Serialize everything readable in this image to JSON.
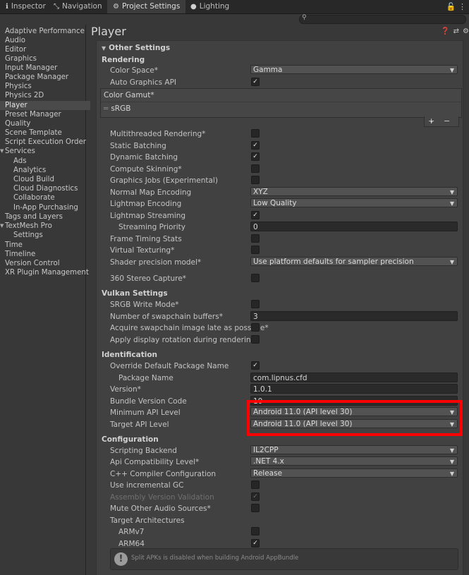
{
  "tabs": [
    {
      "label": "Inspector",
      "icon": "info-icon"
    },
    {
      "label": "Navigation",
      "icon": "navigation-icon"
    },
    {
      "label": "Project Settings",
      "icon": "gear-icon"
    },
    {
      "label": "Lighting",
      "icon": "bulb-icon"
    }
  ],
  "sidebar": {
    "items": [
      {
        "label": "Adaptive Performance"
      },
      {
        "label": "Audio"
      },
      {
        "label": "Editor"
      },
      {
        "label": "Graphics"
      },
      {
        "label": "Input Manager"
      },
      {
        "label": "Package Manager"
      },
      {
        "label": "Physics"
      },
      {
        "label": "Physics 2D"
      },
      {
        "label": "Player"
      },
      {
        "label": "Preset Manager"
      },
      {
        "label": "Quality"
      },
      {
        "label": "Scene Template"
      },
      {
        "label": "Script Execution Order"
      },
      {
        "label": "Services"
      },
      {
        "label": "Ads"
      },
      {
        "label": "Analytics"
      },
      {
        "label": "Cloud Build"
      },
      {
        "label": "Cloud Diagnostics"
      },
      {
        "label": "Collaborate"
      },
      {
        "label": "In-App Purchasing"
      },
      {
        "label": "Tags and Layers"
      },
      {
        "label": "TextMesh Pro"
      },
      {
        "label": "Settings"
      },
      {
        "label": "Time"
      },
      {
        "label": "Timeline"
      },
      {
        "label": "Version Control"
      },
      {
        "label": "XR Plugin Management"
      }
    ],
    "selected": "Player"
  },
  "main": {
    "title": "Player",
    "foldout": "Other Settings",
    "sections": {
      "rendering": "Rendering",
      "vulkan": "Vulkan Settings",
      "identification": "Identification",
      "configuration": "Configuration"
    },
    "fields": {
      "color_space": {
        "label": "Color Space*",
        "value": "Gamma"
      },
      "auto_graphics_api": {
        "label": "Auto Graphics API",
        "checked": true
      },
      "color_gamut": {
        "label": "Color Gamut*",
        "item": "sRGB"
      },
      "multithreaded": {
        "label": "Multithreaded Rendering*",
        "checked": false
      },
      "static_batching": {
        "label": "Static Batching",
        "checked": true
      },
      "dynamic_batching": {
        "label": "Dynamic Batching",
        "checked": true
      },
      "compute_skinning": {
        "label": "Compute Skinning*",
        "checked": false
      },
      "graphics_jobs": {
        "label": "Graphics Jobs (Experimental)",
        "checked": false
      },
      "normal_map": {
        "label": "Normal Map Encoding",
        "value": "XYZ"
      },
      "lightmap_encoding": {
        "label": "Lightmap Encoding",
        "value": "Low Quality"
      },
      "lightmap_streaming": {
        "label": "Lightmap Streaming",
        "checked": true
      },
      "streaming_priority": {
        "label": "Streaming Priority",
        "value": "0"
      },
      "frame_timing": {
        "label": "Frame Timing Stats",
        "checked": false
      },
      "virtual_texturing": {
        "label": "Virtual Texturing*",
        "checked": false
      },
      "shader_precision": {
        "label": "Shader precision model*",
        "value": "Use platform defaults for sampler precision"
      },
      "stereo_capture": {
        "label": "360 Stereo Capture*",
        "checked": false
      },
      "srgb_write": {
        "label": "SRGB Write Mode*",
        "checked": false
      },
      "swapchain_buffers": {
        "label": "Number of swapchain buffers*",
        "value": "3"
      },
      "acquire_swapchain": {
        "label": "Acquire swapchain image late as possible*",
        "checked": false
      },
      "display_rotation": {
        "label": "Apply display rotation during rendering",
        "checked": false
      },
      "override_package": {
        "label": "Override Default Package Name",
        "checked": true
      },
      "package_name": {
        "label": "Package Name",
        "value": "com.lipnus.cfd"
      },
      "version": {
        "label": "Version*",
        "value": "1.0.1"
      },
      "bundle_code": {
        "label": "Bundle Version Code",
        "value": "10"
      },
      "min_api": {
        "label": "Minimum API Level",
        "value": "Android 11.0 (API level 30)"
      },
      "target_api": {
        "label": "Target API Level",
        "value": "Android 11.0 (API level 30)"
      },
      "scripting_backend": {
        "label": "Scripting Backend",
        "value": "IL2CPP"
      },
      "api_compat": {
        "label": "Api Compatibility Level*",
        "value": ".NET 4.x"
      },
      "cpp_compiler": {
        "label": "C++ Compiler Configuration",
        "value": "Release"
      },
      "incremental_gc": {
        "label": "Use incremental GC",
        "checked": false
      },
      "assembly_validation": {
        "label": "Assembly Version Validation",
        "checked": true
      },
      "mute_audio": {
        "label": "Mute Other Audio Sources*",
        "checked": false
      },
      "target_arch": {
        "label": "Target Architectures"
      },
      "armv7": {
        "label": "ARMv7",
        "checked": false
      },
      "arm64": {
        "label": "ARM64",
        "checked": true
      }
    },
    "warning": "Split APKs is disabled when building Android AppBundle"
  },
  "colors": {
    "highlight": "#ff0000",
    "panel": "#414141",
    "background": "#383838"
  }
}
